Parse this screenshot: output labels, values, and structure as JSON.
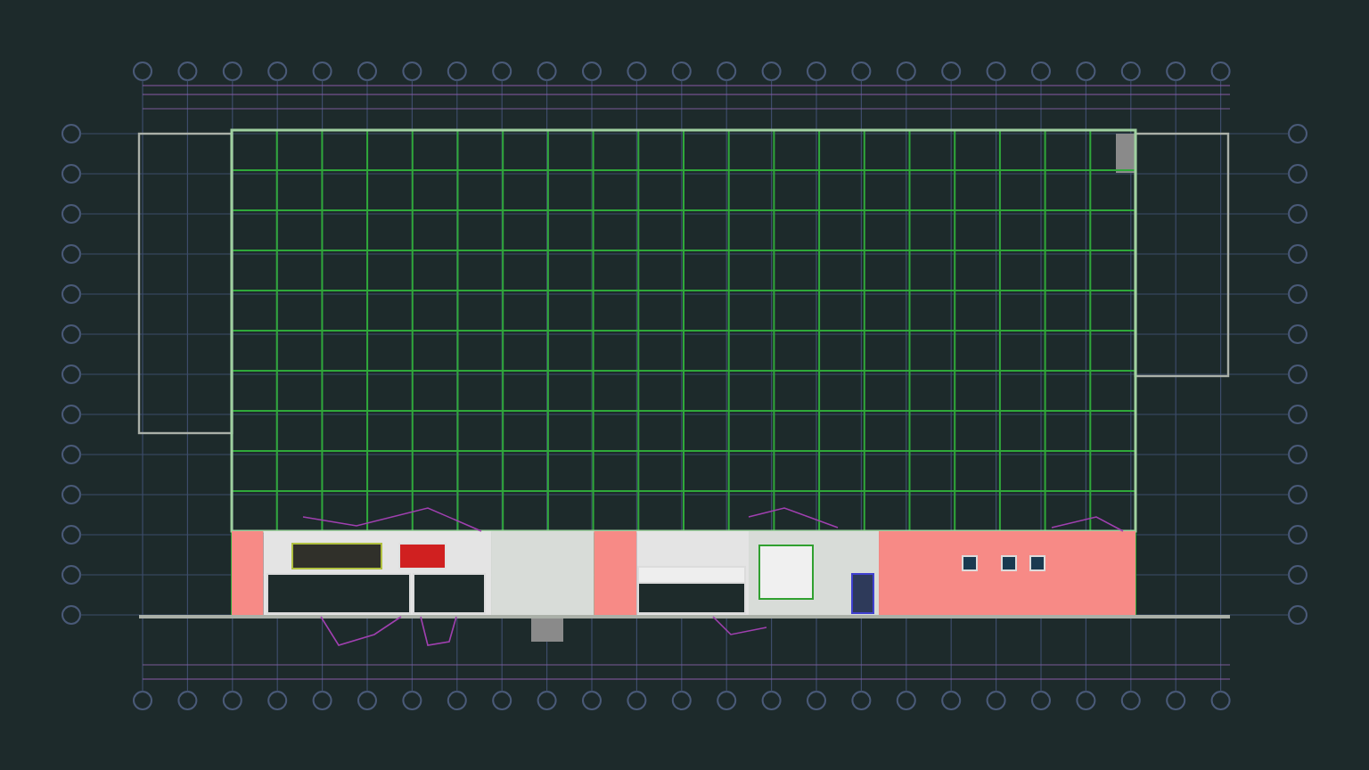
{
  "floor_plan": {
    "zones": [
      {
        "kind": "highlight"
      },
      {
        "kind": "rooms"
      },
      {
        "kind": "open"
      },
      {
        "kind": "highlight"
      },
      {
        "kind": "rooms"
      },
      {
        "kind": "open"
      },
      {
        "kind": "highlight"
      }
    ]
  }
}
